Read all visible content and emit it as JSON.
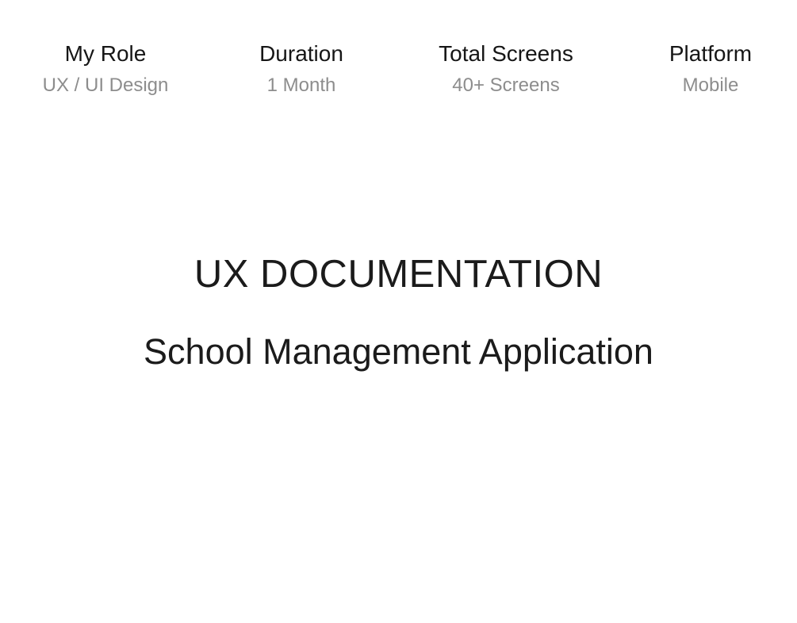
{
  "meta": [
    {
      "label": "My Role",
      "value": "UX / UI Design"
    },
    {
      "label": "Duration",
      "value": "1 Month"
    },
    {
      "label": "Total Screens",
      "value": "40+ Screens"
    },
    {
      "label": "Platform",
      "value": "Mobile"
    }
  ],
  "document": {
    "title": "UX DOCUMENTATION",
    "subtitle": "School Management Application"
  },
  "colors": {
    "label_text": "#161616",
    "value_text": "#8d8d8d",
    "title_text": "#1b1b1b",
    "background": "#ffffff"
  }
}
